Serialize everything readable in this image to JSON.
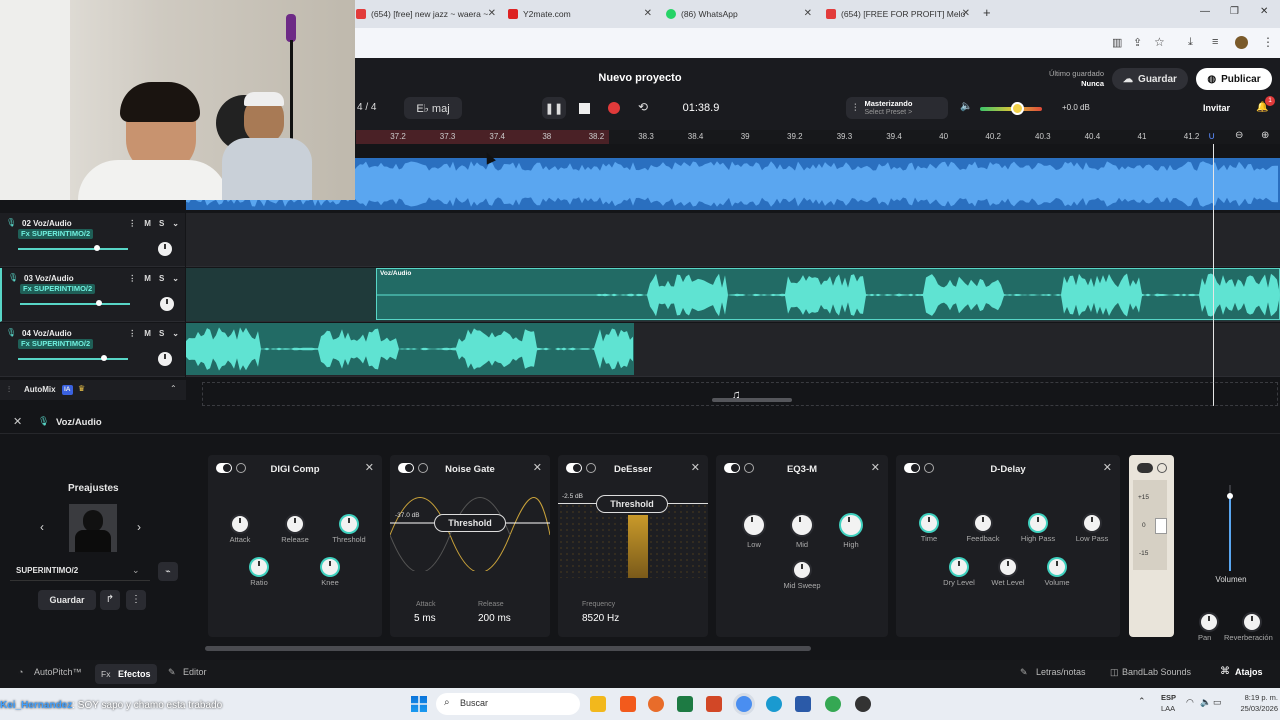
{
  "browser": {
    "tabs": [
      {
        "label": "(654) [free] new jazz ~ waera ~",
        "color": "#e23b3b"
      },
      {
        "label": "Y2mate.com",
        "color": "#d22"
      },
      {
        "label": "(86) WhatsApp",
        "color": "#25d366"
      },
      {
        "label": "(654) [FREE FOR PROFIT] Melo",
        "color": "#e23b3b"
      }
    ],
    "new_tab": "+"
  },
  "app": {
    "project_title": "Nuevo proyecto",
    "last_saved_label": "Último guardado",
    "last_saved_value": "Nunca",
    "save_label": "Guardar",
    "publish_label": "Publicar",
    "invite_label": "Invitar",
    "notifications_count": "1",
    "time_sig": "4 / 4",
    "key": "E♭ maj",
    "time": "01:38.9",
    "mastering_title": "Masterizando",
    "mastering_sub": "Select Preset >",
    "volume_db": "+0.0 dB",
    "volume_level": 0.6
  },
  "ruler": {
    "ticks": [
      "37.2",
      "37.3",
      "37.4",
      "38",
      "38.2",
      "38.3",
      "38.4",
      "39",
      "39.2",
      "39.3",
      "39.4",
      "40",
      "40.2",
      "40.3",
      "40.4",
      "41",
      "41.2"
    ]
  },
  "tracks": [
    {
      "name": "02 Voz/Audio",
      "fx": "Fx SUPERINTIMO/2",
      "m": "M",
      "s": "S",
      "volume": 0.72
    },
    {
      "name": "03 Voz/Audio",
      "fx": "Fx SUPERINTIMO/2",
      "m": "M",
      "s": "S",
      "volume": 0.72,
      "clip": "Voz/Audio"
    },
    {
      "name": "04 Voz/Audio",
      "fx": "Fx SUPERINTIMO/2",
      "m": "M",
      "s": "S",
      "volume": 0.78
    }
  ],
  "automix": {
    "label": "AutoMix",
    "badge": "IA"
  },
  "fx_panel": {
    "track": "Voz/Audio",
    "presets_title": "Preajustes",
    "preset_name": "SUPERINTIMO/2",
    "save_label": "Guardar",
    "plugins": [
      {
        "title": "DIGI Comp",
        "knobs": [
          "Attack",
          "Release",
          "Threshold",
          "Ratio",
          "Knee"
        ]
      },
      {
        "title": "Noise Gate",
        "threshold": "Threshold",
        "db": "-37.0 dB",
        "attack_label": "Attack",
        "attack": "5 ms",
        "release_label": "Release",
        "release": "200 ms"
      },
      {
        "title": "DeEsser",
        "threshold": "Threshold",
        "db": "-2.5 dB",
        "freq_label": "Frequency",
        "freq": "8520 Hz"
      },
      {
        "title": "EQ3-M",
        "knobs": [
          "Low",
          "Mid",
          "High",
          "Mid Sweep"
        ]
      },
      {
        "title": "D-Delay",
        "knobs": [
          "Time",
          "Feedback",
          "High Pass",
          "Low Pass",
          "Dry Level",
          "Wet Level",
          "Volume"
        ]
      }
    ],
    "meter_marks": [
      "+15",
      "0",
      "-15"
    ],
    "volume_label": "Volumen",
    "pan_label": "Pan",
    "reverb_label": "Reverberación"
  },
  "bottom": {
    "autopitch": "AutoPitch™",
    "effects": "Efectos",
    "editor": "Editor",
    "lyrics": "Letras/notas",
    "sounds": "BandLab Sounds",
    "shortcuts": "Atajos"
  },
  "chat": {
    "user": "Kei_Hernandez",
    "message": ": SOY sapo y chamo esta trabado"
  },
  "taskbar": {
    "search": "Buscar",
    "lang1": "ESP",
    "lang2": "LAA",
    "time": "8:19 p. m.",
    "date": "25/03/2026"
  }
}
